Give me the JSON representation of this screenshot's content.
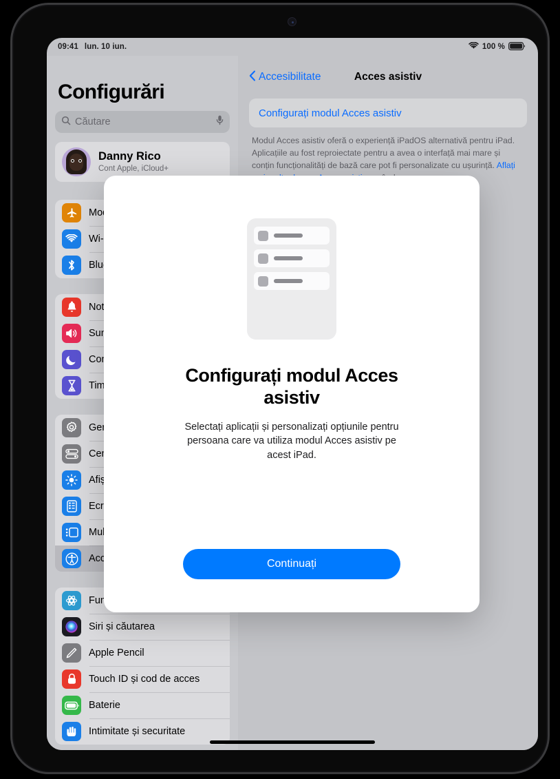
{
  "status_bar": {
    "time": "09:41",
    "date": "lun. 10 iun.",
    "wifi_icon": "wifi-icon",
    "battery_percent": "100 %",
    "battery_icon": "battery-full-icon"
  },
  "sidebar": {
    "title": "Configurări",
    "search": {
      "icon": "search-icon",
      "placeholder": "Căutare",
      "value": "",
      "mic_icon": "microphone-icon"
    },
    "account": {
      "name": "Danny Rico",
      "subtitle": "Cont Apple, iCloud+",
      "avatar": "memoji-avatar"
    },
    "groups": [
      {
        "items": [
          {
            "label": "Mod Avion",
            "icon": "airplane-icon",
            "color": "#e08407",
            "selected": false
          },
          {
            "label": "Wi-Fi",
            "icon": "wifi-icon",
            "color": "#1a7fe8",
            "selected": false
          },
          {
            "label": "Bluetooth",
            "icon": "bluetooth-icon",
            "color": "#1a7fe8",
            "selected": false
          }
        ]
      },
      {
        "items": [
          {
            "label": "Notificări",
            "icon": "bell-icon",
            "color": "#e8372b",
            "selected": false
          },
          {
            "label": "Sunete",
            "icon": "speaker-icon",
            "color": "#e52b56",
            "selected": false
          },
          {
            "label": "Concentrare",
            "icon": "moon-icon",
            "color": "#5a52cf",
            "selected": false
          },
          {
            "label": "Timp de utilizare",
            "icon": "hourglass-icon",
            "color": "#5a52cf",
            "selected": false
          }
        ]
      },
      {
        "items": [
          {
            "label": "General",
            "icon": "gear-icon",
            "color": "#7c7c80",
            "selected": false
          },
          {
            "label": "Centru de control",
            "icon": "control-toggles-icon",
            "color": "#7c7c80",
            "selected": false
          },
          {
            "label": "Afișaj și luminozitate",
            "icon": "brightness-icon",
            "color": "#1a7fe8",
            "selected": false
          },
          {
            "label": "Ecran principal și Galerie apps",
            "icon": "home-screen-icon",
            "color": "#1a7fe8",
            "selected": false
          },
          {
            "label": "Multitasking și gesturi",
            "icon": "multitasking-icon",
            "color": "#1a7fe8",
            "selected": false
          },
          {
            "label": "Accesibilitate",
            "icon": "accessibility-icon",
            "color": "#1a7fe8",
            "selected": true
          }
        ]
      },
      {
        "items": [
          {
            "label": "Fundal",
            "icon": "wallpaper-icon",
            "color": "#2d9bd0",
            "selected": false
          },
          {
            "label": "Siri și căutarea",
            "icon": "siri-icon",
            "color": "#1c1c22",
            "selected": false
          },
          {
            "label": "Apple Pencil",
            "icon": "pencil-icon",
            "color": "#7c7c80",
            "selected": false
          },
          {
            "label": "Touch ID și cod de acces",
            "icon": "lock-icon",
            "color": "#e8372b",
            "selected": false
          },
          {
            "label": "Baterie",
            "icon": "battery-icon",
            "color": "#35b84a",
            "selected": false
          },
          {
            "label": "Intimitate și securitate",
            "icon": "privacy-hand-icon",
            "color": "#1a7fe8",
            "selected": false
          }
        ]
      }
    ]
  },
  "detail": {
    "back_label": "Accesibilitate",
    "back_icon": "chevron-left-icon",
    "title": "Acces asistiv",
    "action_label": "Configurați modul Acces asistiv",
    "description": "Modul Acces asistiv oferă o experiență iPadOS alternativă pentru iPad. Aplicațiile au fost reproiectate pentru a avea o interfață mai mare și conțin funcționalități de bază care pot fi personalizate cu ușurință.",
    "learn_more": "Aflați mai multe despre Acces asistiv…",
    "obscured_fragment": "când"
  },
  "modal": {
    "illustration": "assistive-access-app-list-illustration",
    "title": "Configurați modul Acces asistiv",
    "body": "Selectați aplicații și personalizați opțiunile pentru persoana care va utiliza modul Acces asistiv pe acest iPad.",
    "continue_label": "Continuați"
  },
  "colors": {
    "accent_blue": "#007aff",
    "link_blue": "#0a6cff",
    "screen_bg": "#c3c4c8",
    "sidebar_bg": "#c8c9cd",
    "modal_bg": "#ffffff"
  },
  "home_indicator": "home-indicator"
}
